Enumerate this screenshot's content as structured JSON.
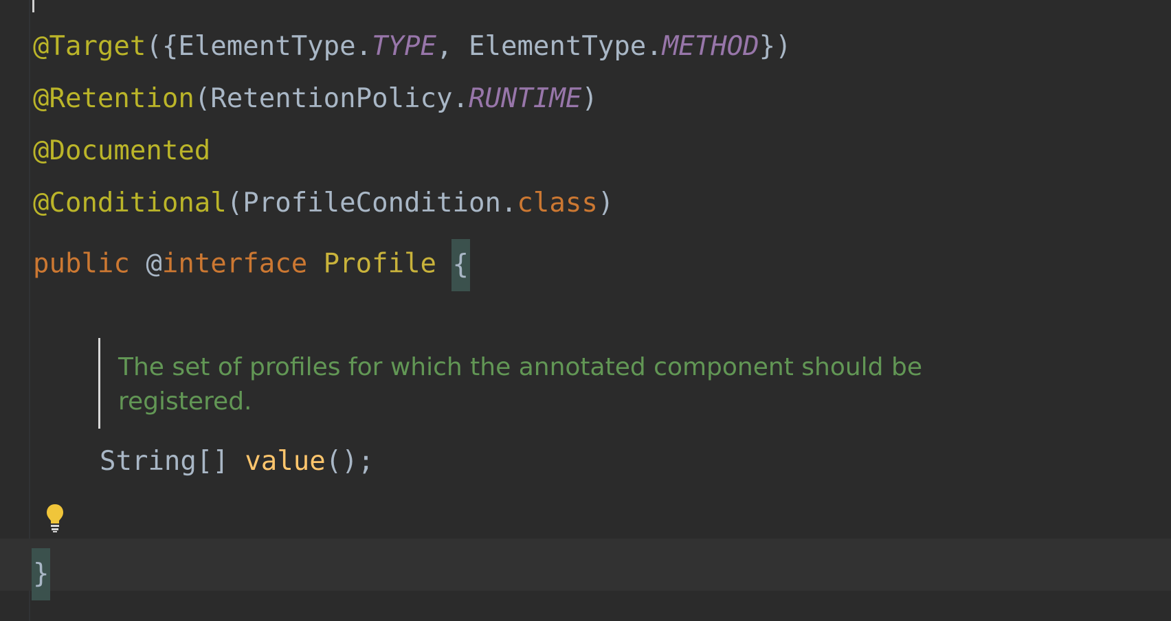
{
  "code": {
    "line1": {
      "annotation": "@Target",
      "open": "({",
      "type_prefix": "ElementType.",
      "type_const": "TYPE",
      "sep": ", ",
      "method_prefix": "ElementType.",
      "method_const": "METHOD",
      "close": "})"
    },
    "line2": {
      "annotation": "@Retention",
      "open": "(",
      "prefix": "RetentionPolicy.",
      "const": "RUNTIME",
      "close": ")"
    },
    "line3": {
      "annotation": "@Documented"
    },
    "line4": {
      "annotation": "@Conditional",
      "open": "(",
      "prefix": "ProfileCondition.",
      "keyword": "class",
      "close": ")"
    },
    "line5": {
      "keyword_public": "public",
      "at": "@",
      "keyword_interface": "interface",
      "name": "Profile",
      "brace": "{"
    },
    "doc": {
      "text": "The set of profiles for which the annotated component should be registered."
    },
    "line7": {
      "type": "String[]",
      "method": "value",
      "tail": "();"
    },
    "line9": {
      "brace": "}"
    }
  },
  "icons": {
    "intention_bulb": "lightbulb-icon"
  },
  "colors": {
    "background": "#2b2b2b",
    "annotation": "#bbb529",
    "keyword": "#cc7832",
    "constant": "#9876aa",
    "doc": "#629755",
    "method": "#ffc66d"
  }
}
